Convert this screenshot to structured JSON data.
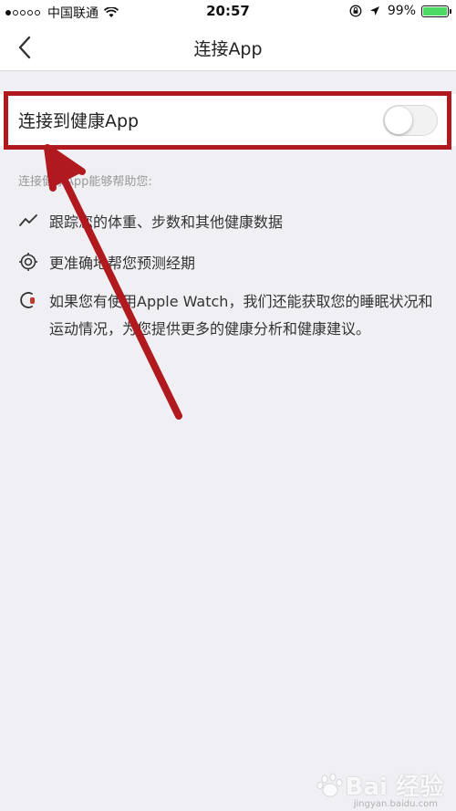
{
  "status_bar": {
    "carrier": "中国联通",
    "time": "20:57",
    "battery_percent": "99%",
    "battery_level": 0.99
  },
  "nav": {
    "title": "连接App",
    "back_icon": "chevron-left-icon"
  },
  "toggle": {
    "label": "连接到健康App",
    "on": false
  },
  "section": {
    "heading": "连接健康App能够帮助您:"
  },
  "features": [
    {
      "icon": "trend-line-icon",
      "text": "跟踪您的体重、步数和其他健康数据"
    },
    {
      "icon": "target-icon",
      "text": "更准确地帮您预测经期"
    },
    {
      "icon": "watch-icon",
      "text": "如果您有使用Apple Watch，我们还能获取您的睡眠状况和运动情况，为您提供更多的健康分析和健康建议。"
    }
  ],
  "colors": {
    "annotation_red": "#b01a1e",
    "battery_green": "#4cd964",
    "background": "#efeff4"
  },
  "watermark": {
    "text": "Bai 经验",
    "sub": "jingyan.baidu.com"
  }
}
